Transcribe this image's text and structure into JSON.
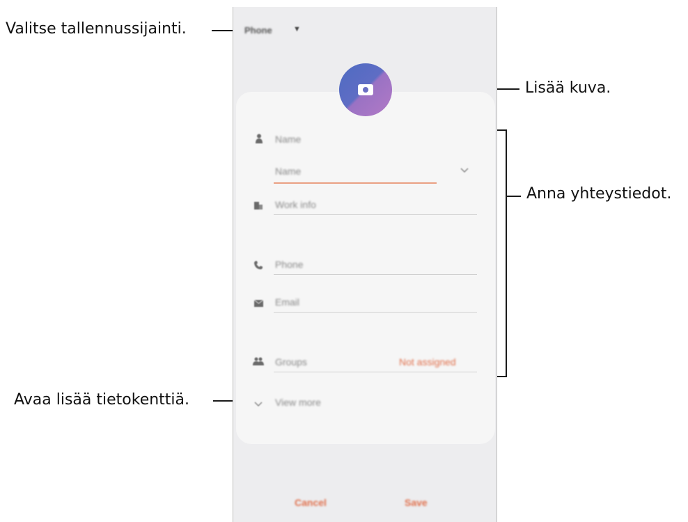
{
  "annotations": {
    "storage": "Valitse tallennussijainti.",
    "photo": "Lisää kuva.",
    "contact_info": "Anna yhteystiedot.",
    "more_fields": "Avaa lisää tietokenttiä."
  },
  "phone": {
    "storage_label": "Phone",
    "fields": {
      "name_header": "Name",
      "name_input": "Name",
      "work_info": "Work info",
      "phone": "Phone",
      "email": "Email",
      "groups": "Groups",
      "groups_value": "Not assigned"
    },
    "view_more": "View more",
    "cancel": "Cancel",
    "save": "Save"
  },
  "icons": {
    "storage_dropdown": "caret-down-icon",
    "avatar": "camera-icon",
    "name": "person-icon",
    "name_expand": "chevron-down-icon",
    "work": "building-icon",
    "phone": "phone-icon",
    "email": "envelope-icon",
    "groups": "group-icon",
    "view_more": "chevron-down-icon"
  },
  "colors": {
    "accent": "#e0704c",
    "avatar_start": "#4e6bc2",
    "avatar_end": "#b27ac6",
    "background": "#ededef",
    "card": "#f6f6f6"
  }
}
